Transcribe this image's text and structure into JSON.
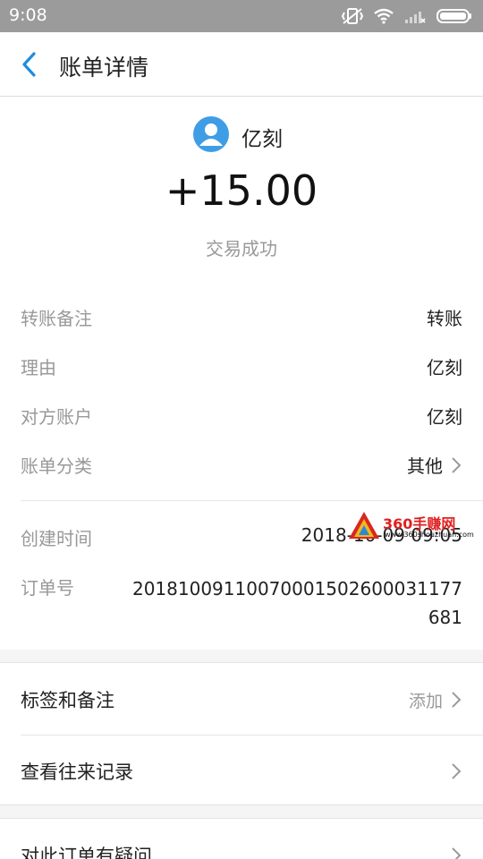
{
  "status_bar": {
    "time": "9:08"
  },
  "nav": {
    "title": "账单详情"
  },
  "counterparty": {
    "name": "亿刻"
  },
  "transaction": {
    "amount": "+15.00",
    "status": "交易成功"
  },
  "details": [
    {
      "label": "转账备注",
      "value": "转账"
    },
    {
      "label": "理由",
      "value": "亿刻"
    },
    {
      "label": "对方账户",
      "value": "亿刻"
    },
    {
      "label": "账单分类",
      "value": "其他"
    }
  ],
  "meta": {
    "created_label": "创建时间",
    "created_value": "2018-10-09 09:05",
    "order_label": "订单号",
    "order_value": "20181009110070001502600031177681"
  },
  "actions": {
    "tags_label": "标签和备注",
    "tags_action": "添加",
    "history_label": "查看往来记录",
    "question_label": "对此订单有疑问"
  },
  "watermark": {
    "brand": "360手赚网",
    "url": "www.360shouzhuan.com"
  },
  "colors": {
    "accent": "#1e8de0",
    "status_bar": "#9b9b9b",
    "avatar": "#3f9de6",
    "muted": "#999999"
  }
}
